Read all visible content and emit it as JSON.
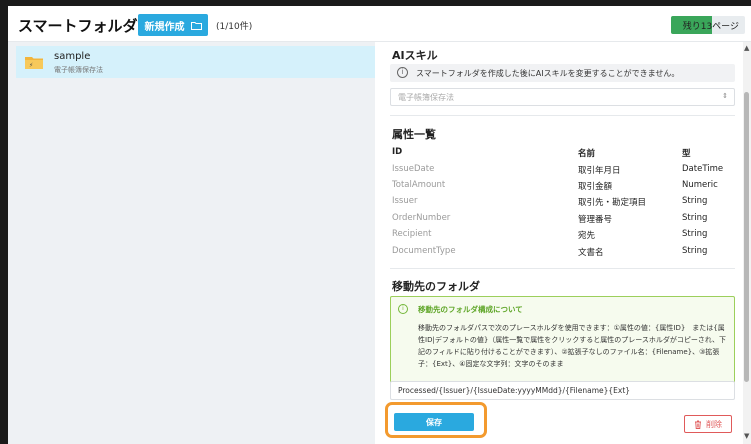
{
  "header": {
    "title": "スマートフォルダ管理",
    "new_button_label": "新規作成",
    "count": "(1/10件)",
    "pages_remaining": "残り13ページ",
    "pages_fill_fraction": 0.55
  },
  "sidebar": {
    "folders": [
      {
        "name": "sample",
        "subtitle": "電子帳簿保存法"
      }
    ]
  },
  "ai_skill": {
    "title": "AIスキル",
    "notice": "スマートフォルダを作成した後にAIスキルを変更することができません。",
    "selected_value": "電子帳簿保存法"
  },
  "attributes": {
    "title": "属性一覧",
    "columns": {
      "id": "ID",
      "name": "名前",
      "type": "型"
    },
    "rows": [
      {
        "id": "IssueDate",
        "name": "取引年月日",
        "type": "DateTime"
      },
      {
        "id": "TotalAmount",
        "name": "取引金額",
        "type": "Numeric"
      },
      {
        "id": "Issuer",
        "name": "取引先・勘定項目",
        "type": "String"
      },
      {
        "id": "OrderNumber",
        "name": "管理番号",
        "type": "String"
      },
      {
        "id": "Recipient",
        "name": "宛先",
        "type": "String"
      },
      {
        "id": "DocumentType",
        "name": "文書名",
        "type": "String"
      }
    ]
  },
  "destination": {
    "title": "移動先のフォルダ",
    "info_title": "移動先のフォルダ構成について",
    "info_body": "移動先のフォルダパスで次のプレースホルダを使用できます：①属性の値：{属性ID}　または{属性ID|デフォルトの値}（属性一覧で属性をクリックすると属性のプレースホルダがコピーされ、下記のフィルドに貼り付けることができます）、②拡張子なしのファイル名：{Filename}、③拡張子：{Ext}、④固定な文字列：文字のそのまま",
    "path_value": "Processed/{Issuer}/{IssueDate:yyyyMMdd}/{Filename}{Ext}"
  },
  "actions": {
    "save_label": "保存",
    "delete_label": "削除"
  },
  "colors": {
    "accent": "#2aa9df",
    "selected_row": "#d5f1fb",
    "progress": "#3aa65a",
    "highlight_ring": "#f39a2e",
    "danger": "#e05a5a",
    "info_green": "#5fa628"
  }
}
